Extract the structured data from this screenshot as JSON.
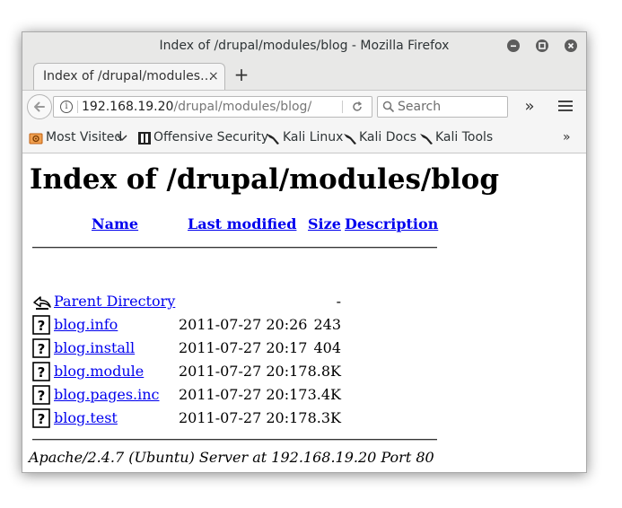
{
  "window": {
    "title": "Index of /drupal/modules/blog - Mozilla Firefox"
  },
  "tabs": [
    {
      "label": "Index of /drupal/modules…",
      "close": "×"
    }
  ],
  "newtab": "+",
  "navbar": {
    "url_host": "192.168.19.20",
    "url_path": "/drupal/modules/blog/",
    "search_placeholder": "Search",
    "overflow": "»"
  },
  "bookmarks": {
    "items": [
      {
        "label": "Most Visited",
        "icon": "gear-folder-icon"
      },
      {
        "label": "Offensive Security",
        "icon": "offsec-icon"
      },
      {
        "label": "Kali Linux",
        "icon": "kali-dragon-icon"
      },
      {
        "label": "Kali Docs",
        "icon": "kali-dragon-icon"
      },
      {
        "label": "Kali Tools",
        "icon": "kali-dragon-icon"
      }
    ],
    "more": "»"
  },
  "page": {
    "heading": "Index of /drupal/modules/blog",
    "columns": {
      "name": "Name",
      "last_modified": "Last modified",
      "size": "Size",
      "description": "Description"
    },
    "rows": [
      {
        "name": "Parent Directory",
        "date": "",
        "size": "-",
        "icon": "back-arrow-icon"
      },
      {
        "name": "blog.info",
        "date": "2011-07-27 20:26",
        "size": "243",
        "icon": "unknown-file-icon"
      },
      {
        "name": "blog.install",
        "date": "2011-07-27 20:17",
        "size": "404",
        "icon": "unknown-file-icon"
      },
      {
        "name": "blog.module",
        "date": "2011-07-27 20:17",
        "size": "8.8K",
        "icon": "unknown-file-icon"
      },
      {
        "name": "blog.pages.inc",
        "date": "2011-07-27 20:17",
        "size": "3.4K",
        "icon": "unknown-file-icon"
      },
      {
        "name": "blog.test",
        "date": "2011-07-27 20:17",
        "size": "8.3K",
        "icon": "unknown-file-icon"
      }
    ],
    "footer": "Apache/2.4.7 (Ubuntu) Server at 192.168.19.20 Port 80"
  },
  "colors": {
    "link": "#0000ee",
    "titlebar": "#e8e8e7",
    "window_button": "#5c5c5c"
  }
}
